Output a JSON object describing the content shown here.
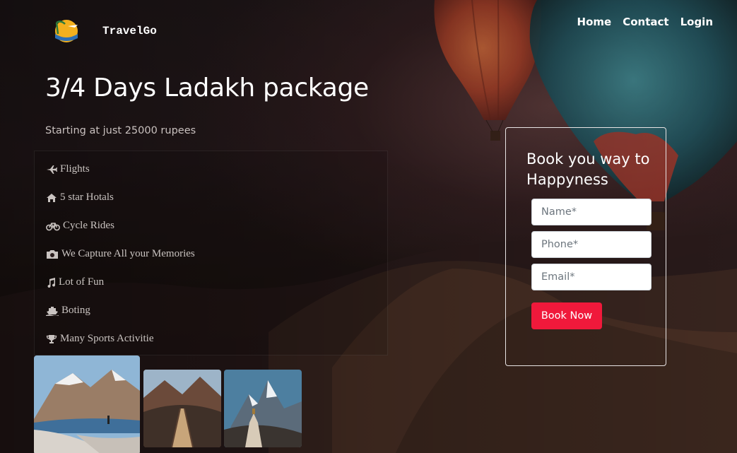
{
  "header": {
    "brand": "TravelGo",
    "nav": [
      {
        "label": "Home"
      },
      {
        "label": "Contact"
      },
      {
        "label": "Login"
      }
    ]
  },
  "hero": {
    "title": "3/4 Days Ladakh package",
    "subtitle": "Starting at just 25000 rupees"
  },
  "features": [
    {
      "icon": "plane-icon",
      "label": "Flights"
    },
    {
      "icon": "home-icon",
      "label": "5 star Hotals"
    },
    {
      "icon": "bicycle-icon",
      "label": "Cycle Rides"
    },
    {
      "icon": "camera-icon",
      "label": "We Capture All your Memories"
    },
    {
      "icon": "music-icon",
      "label": "Lot of Fun"
    },
    {
      "icon": "ship-icon",
      "label": "Boting"
    },
    {
      "icon": "trophy-icon",
      "label": "Many Sports Activitie"
    }
  ],
  "booking": {
    "title": "Book you way to Happyness",
    "name_placeholder": "Name*",
    "phone_placeholder": "Phone*",
    "email_placeholder": "Email*",
    "button_label": "Book Now"
  },
  "colors": {
    "accent": "#f0193b",
    "feature_text": "#c9c3c0"
  }
}
